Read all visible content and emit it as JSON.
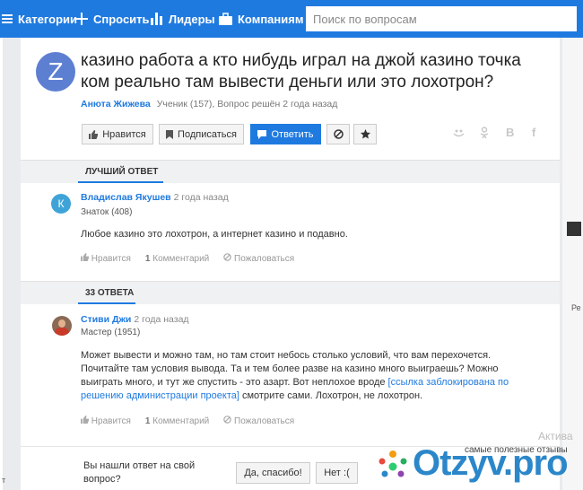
{
  "nav": {
    "categories": "Категории",
    "ask": "Спросить",
    "leaders": "Лидеры",
    "companies": "Компаниям",
    "search_placeholder": "Поиск по вопросам"
  },
  "question": {
    "avatar_letter": "Z",
    "title": "казино работа а кто нибудь играл на джой казино точка ком реально там вывести деньги или это лохотрон?",
    "author": "Анюта Жижева",
    "meta": "Ученик (157), Вопрос решён 2 года назад",
    "buttons": {
      "like": "Нравится",
      "subscribe": "Подписаться",
      "answer": "Ответить"
    },
    "share": {
      "ok": "ok",
      "vk": "В",
      "fb": "f"
    }
  },
  "best": {
    "label": "ЛУЧШИЙ ОТВЕТ",
    "avatar_letter": "К",
    "name": "Владислав Якушев",
    "ago": "2 года назад",
    "rank": "Знаток (408)",
    "text": "Любое казино это лохотрон, а интернет казино и подавно.",
    "like": "Нравится",
    "comments_count": "1",
    "comments_label": "Комментарий",
    "complain": "Пожаловаться"
  },
  "answers": {
    "label": "33 ОТВЕТА",
    "name": "Стиви Джи",
    "ago": "2 года назад",
    "rank": "Мастер (1951)",
    "text_1": "Может вывести и можно там, но там стоит небось столько условий, что вам перехочется. Почитайте там условия вывода. Та и тем более разве на казино много выиграешь? Можно выиграть много, и тут же спустить - это азарт. Вот неплохое вроде ",
    "link": "[ссылка заблокирована по решению администрации проекта]",
    "text_2": " смотрите сами. Лохотрон, не лохотрон.",
    "like": "Нравится",
    "comments_count": "1",
    "comments_label": "Комментарий",
    "complain": "Пожаловаться"
  },
  "feedback": {
    "question": "Вы нашли ответ на свой вопрос?",
    "yes": "Да, спасибо!",
    "no": "Нет :("
  },
  "watermark": {
    "active": "Актива",
    "tagline": "самые полезные отзывы",
    "brand": "Otzyv.pro",
    "side_r": "Ре",
    "side_t": "т"
  }
}
